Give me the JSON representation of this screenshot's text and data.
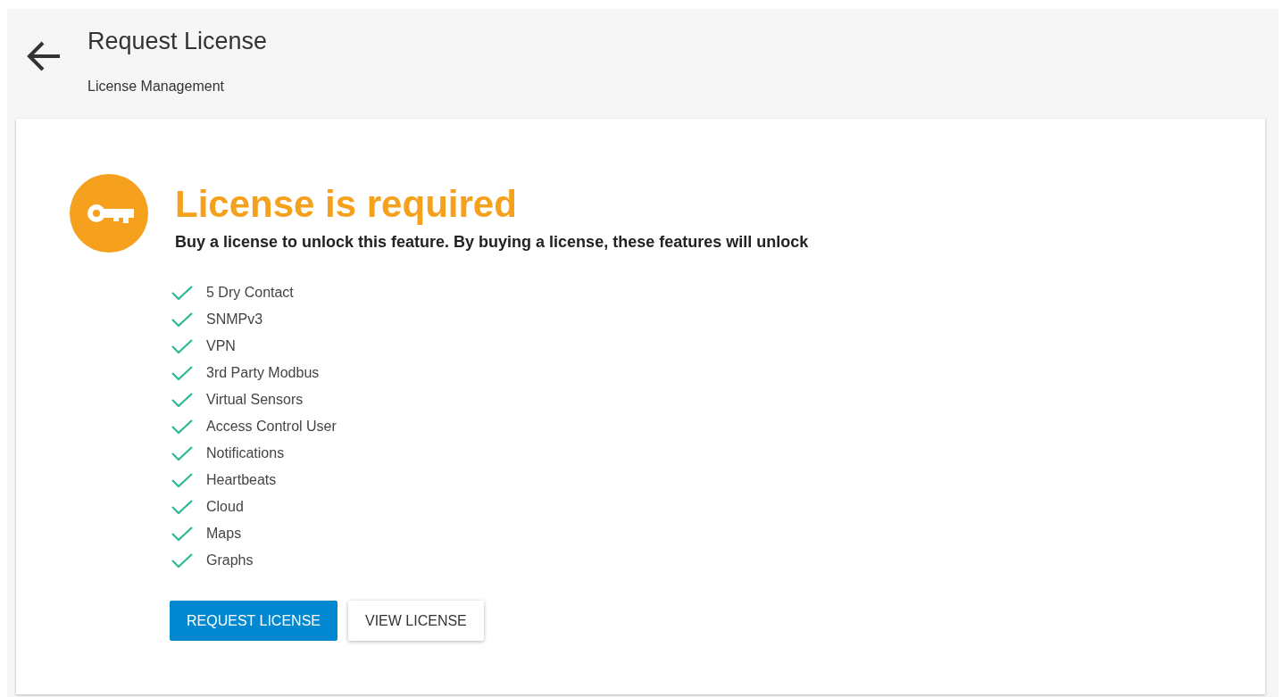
{
  "header": {
    "title": "Request License",
    "subtitle": "License Management"
  },
  "notice": {
    "title": "License is required",
    "description": "Buy a license to unlock this feature. By buying a license, these features will unlock"
  },
  "features": [
    "5 Dry Contact",
    "SNMPv3",
    "VPN",
    "3rd Party Modbus",
    "Virtual Sensors",
    "Access Control User",
    "Notifications",
    "Heartbeats",
    "Cloud",
    "Maps",
    "Graphs"
  ],
  "buttons": [
    {
      "label": "REQUEST LICENSE",
      "kind": "primary"
    },
    {
      "label": "VIEW LICENSE",
      "kind": "secondary"
    }
  ]
}
